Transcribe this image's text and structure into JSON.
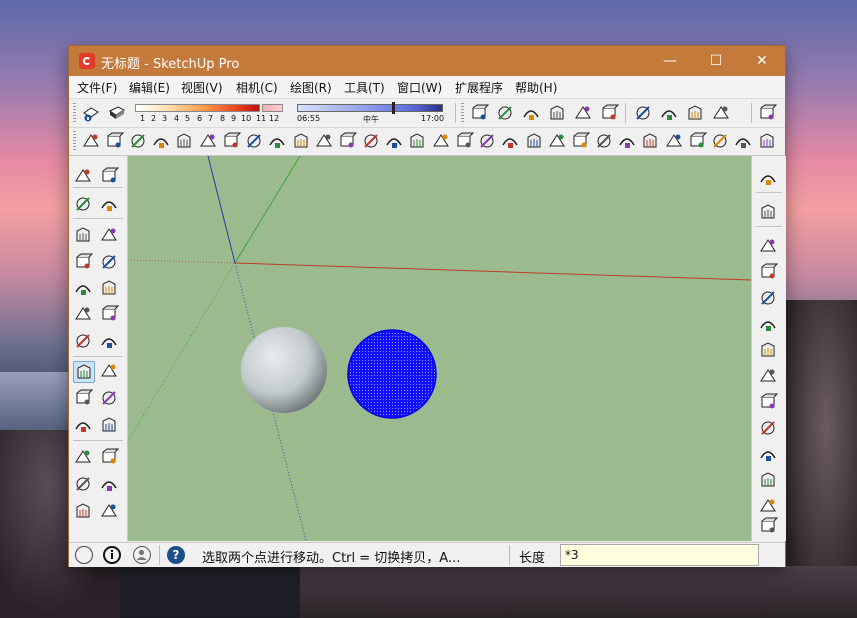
{
  "window": {
    "title": "无标题 - SketchUp Pro",
    "minimize_glyph": "—",
    "maximize_glyph": "☐",
    "close_glyph": "✕"
  },
  "menu": [
    "文件(F)",
    "编辑(E)",
    "视图(V)",
    "相机(C)",
    "绘图(R)",
    "工具(T)",
    "窗口(W)",
    "扩展程序",
    "帮助(H)"
  ],
  "shadow_slider": {
    "ticks": [
      "1",
      "2",
      "3",
      "4",
      "5",
      "6",
      "7",
      "8",
      "9",
      "10",
      "11",
      "12"
    ]
  },
  "time_slider": {
    "start": "06:55",
    "mid": "中午",
    "end": "17:00",
    "position": 0.65
  },
  "toolbars": {
    "row1_left_icons": [
      "shadow-toggle-icon",
      "fog-icon"
    ],
    "row1_right_icons": [
      "select-icon",
      "component-icon",
      "paint-icon",
      "eraser-icon",
      "tape-icon",
      "section-icon",
      "axes-icon",
      "look-icon",
      "walk-icon",
      "position-camera-icon",
      "warehouse-icon"
    ],
    "row2_icons": [
      "pencil-arrow-icon",
      "rectangle-icon",
      "circle-icon",
      "arc-icon",
      "freehand-icon",
      "push-pull-icon",
      "move-icon",
      "rotate-icon",
      "scale-icon",
      "offset-icon",
      "follow-me-icon",
      "intersect-icon",
      "outliner-icon",
      "hidden-line-icon",
      "shaded-icon",
      "textured-icon",
      "xray-icon",
      "back-edges-icon",
      "iso-view-icon",
      "top-view-icon",
      "front-view-icon",
      "right-view-icon",
      "back-view-icon",
      "left-view-icon",
      "sandbox-icon",
      "smoove-icon",
      "stamp-icon",
      "drape-icon",
      "add-detail-icon",
      "flip-edge-icon"
    ],
    "left_tools": [
      [
        "select-arrow-icon",
        "make-component-icon"
      ],
      [
        "paint-bucket-icon",
        "eraser-icon"
      ],
      [
        "pencil-icon",
        "freehand-icon"
      ],
      [
        "rectangle-icon",
        "rotated-rect-icon"
      ],
      [
        "circle-icon",
        "polygon-icon"
      ],
      [
        "arc-icon",
        "arc-2pt-icon"
      ],
      [
        "arc-3pt-icon",
        "pie-icon"
      ],
      [
        "move-icon",
        "push-pull-icon"
      ],
      [
        "rotate-icon",
        "follow-me-icon"
      ],
      [
        "scale-icon",
        "offset-icon"
      ],
      [
        "tape-measure-icon",
        "dimension-icon"
      ],
      [
        "protractor-icon",
        "text-icon"
      ],
      [
        "axes-icon",
        "3d-text-icon"
      ]
    ],
    "right_tools": [
      "sandbox-from-contours-icon",
      "sandbox-from-scratch-icon",
      "smoove-icon",
      "stamp-icon",
      "drape-icon",
      "add-detail-icon",
      "flip-edge-icon",
      "solid-outer-shell-icon",
      "solid-intersect-icon",
      "solid-union-icon",
      "solid-subtract-icon",
      "solid-trim-icon",
      "solid-split-icon",
      "warehouse-icon"
    ]
  },
  "viewport": {
    "background": "#9bbb8f",
    "axis_red": "#c0392b",
    "axis_green": "#3aa53a",
    "axis_blue": "#2a3aa8",
    "sphere_gray": "#c9d0d3",
    "sphere_blue": "#1010ff"
  },
  "status": {
    "text": "选取两个点进行移动。Ctrl = 切换拷贝，A...",
    "measure_label": "长度",
    "measure_value": "*3",
    "icons": [
      "geo-location-icon",
      "credits-icon",
      "user-icon",
      "help-icon"
    ]
  }
}
